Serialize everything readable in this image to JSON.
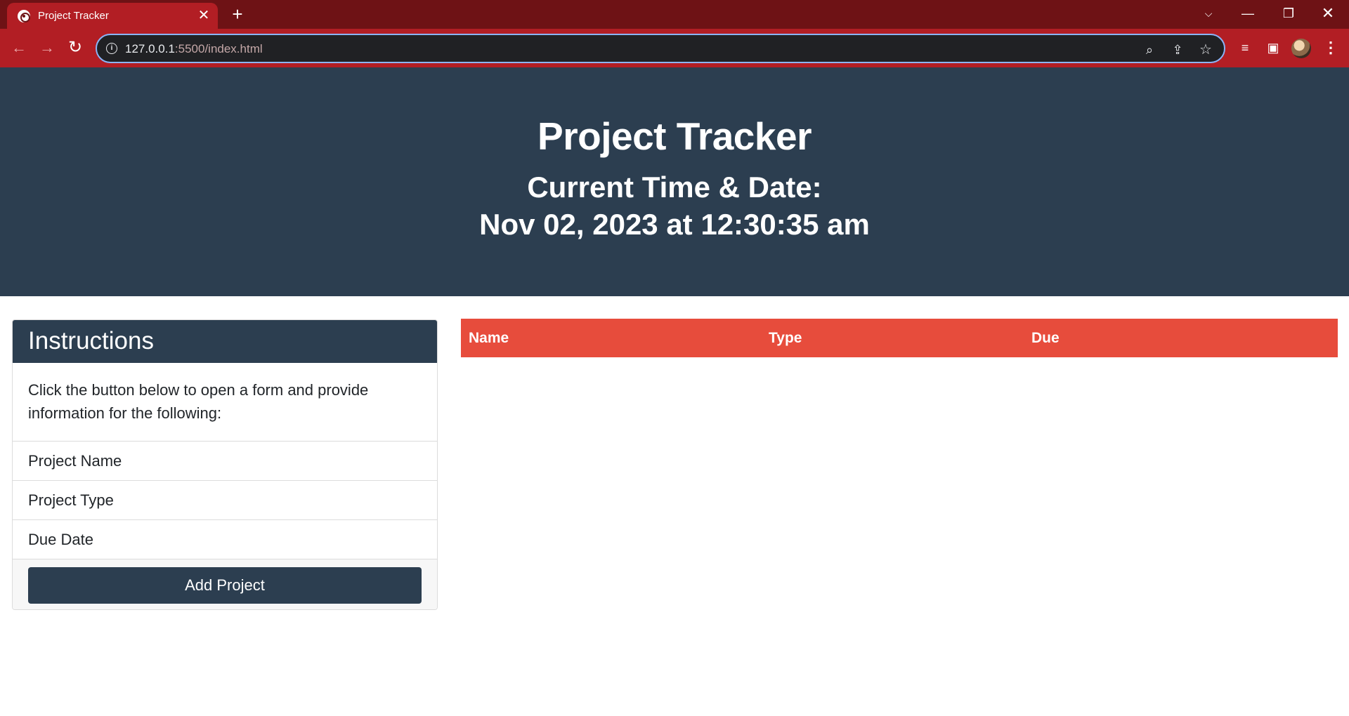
{
  "browser": {
    "tab_title": "Project Tracker",
    "tab_close": "✕",
    "new_tab": "+",
    "url_host": "127.0.0.1",
    "url_rest": ":5500/index.html",
    "window_controls": {
      "tab_search": "⌵",
      "minimize": "—",
      "maximize": "❐",
      "close": "✕"
    },
    "nav": {
      "back": "←",
      "forward": "→",
      "reload": "↻"
    },
    "icons": {
      "info": "i",
      "zoom": "⌕",
      "share": "⇪",
      "star": "☆",
      "media": "≡",
      "side_panel": "▣",
      "menu": "⋮"
    }
  },
  "header": {
    "title": "Project Tracker",
    "time_label": "Current Time & Date:",
    "datetime": "Nov 02, 2023 at 12:30:35 am"
  },
  "instructions": {
    "heading": "Instructions",
    "text": "Click the button below to open a form and provide information for the following:",
    "items": [
      "Project Name",
      "Project Type",
      "Due Date"
    ],
    "button_label": "Add Project"
  },
  "table": {
    "columns": [
      "Name",
      "Type",
      "Due"
    ]
  },
  "colors": {
    "tab_bar": "#6e1215",
    "toolbar": "#b21e24",
    "header_bg": "#2c3e50",
    "table_header_bg": "#e74c3c"
  }
}
